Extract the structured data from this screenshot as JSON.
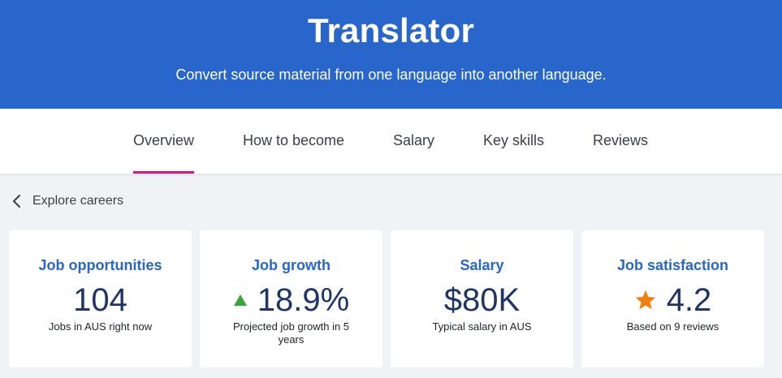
{
  "header": {
    "title": "Translator",
    "subtitle": "Convert source material from one language into another language."
  },
  "tabs": [
    {
      "label": "Overview",
      "active": true
    },
    {
      "label": "How to become",
      "active": false
    },
    {
      "label": "Salary",
      "active": false
    },
    {
      "label": "Key skills",
      "active": false
    },
    {
      "label": "Reviews",
      "active": false
    }
  ],
  "breadcrumb": {
    "back_label": "Explore careers",
    "icon": "chevron-left-icon"
  },
  "cards": [
    {
      "title": "Job opportunities",
      "value": "104",
      "description": "Jobs in AUS right now"
    },
    {
      "title": "Job growth",
      "value": "18.9%",
      "description": "Projected job growth in 5 years",
      "icon": "triangle-up-icon"
    },
    {
      "title": "Salary",
      "value": "$80K",
      "description": "Typical salary in AUS"
    },
    {
      "title": "Job satisfaction",
      "value": "4.2",
      "description": "Based on 9 reviews",
      "icon": "star-icon"
    }
  ],
  "colors": {
    "header_bg": "#2866cc",
    "tab_active_underline": "#e0157a",
    "card_title": "#2866cc",
    "value_text": "#1e3566",
    "growth_arrow": "#3aa53a",
    "star": "#f07f12",
    "page_bg": "#f1f2f6"
  }
}
